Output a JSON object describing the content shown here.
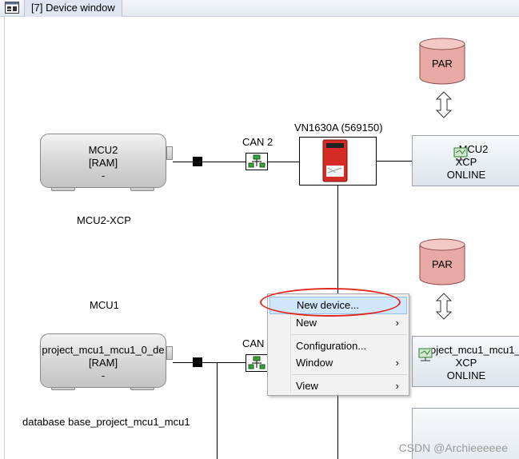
{
  "window": {
    "title": "[7] Device window"
  },
  "devices": {
    "mcu2": {
      "name": "MCU2",
      "memory": "[RAM]",
      "dash": "-",
      "caption": "MCU2-XCP"
    },
    "mcu1": {
      "name": "project_mcu1_mcu1_0_de",
      "memory": "[RAM]",
      "dash": "-",
      "section_label": "MCU1",
      "caption": "database base_project_mcu1_mcu1"
    },
    "can_top": {
      "label": "CAN 2"
    },
    "can_bottom": {
      "label": "CAN 1"
    },
    "interface": {
      "label": "VN1630A (569150)"
    },
    "xcp_top": {
      "name": "MCU2",
      "protocol": "XCP",
      "state": "ONLINE"
    },
    "xcp_bottom": {
      "name": "oject_mcu1_mcu1_",
      "protocol": "XCP",
      "state": "ONLINE"
    },
    "par_top": {
      "label": "PAR"
    },
    "par_bottom": {
      "label": "PAR"
    }
  },
  "context_menu": {
    "items": [
      {
        "label": "New device...",
        "highlighted": true,
        "submenu": false
      },
      {
        "label": "New",
        "highlighted": false,
        "submenu": true
      },
      {
        "label": "Configuration...",
        "highlighted": false,
        "submenu": false
      },
      {
        "label": "Window",
        "highlighted": false,
        "submenu": true
      },
      {
        "label": "View",
        "highlighted": false,
        "submenu": true
      }
    ],
    "arrow_glyph": "›"
  },
  "watermark": "CSDN @Archieeeeee",
  "colors": {
    "highlight_ellipse": "#e0281e",
    "menu_highlight": "#cfe6fb",
    "par_fill": "#e9a8a4"
  }
}
